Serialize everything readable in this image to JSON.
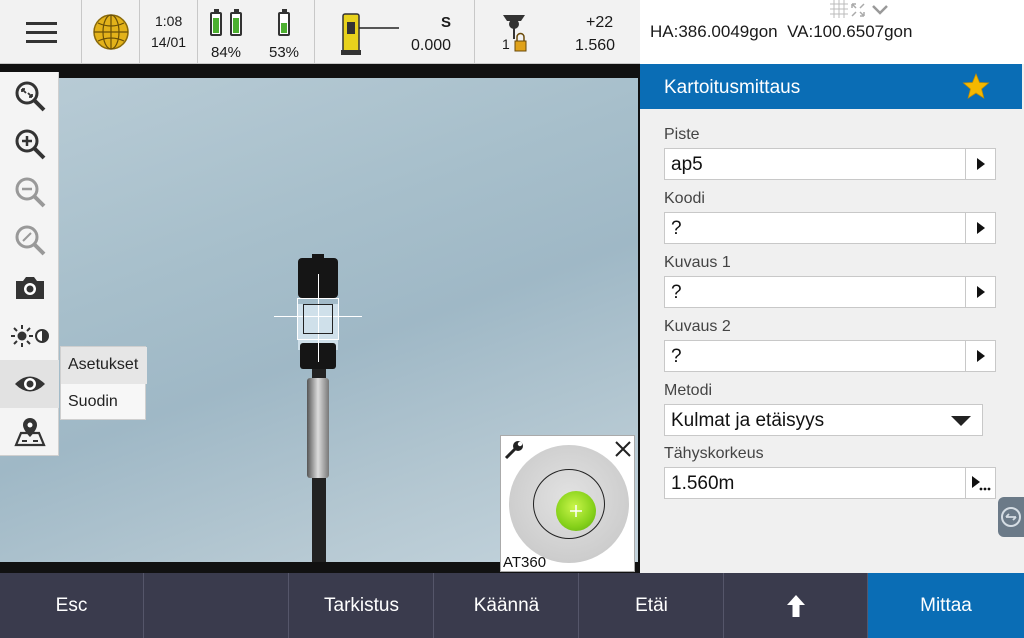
{
  "status_bar": {
    "time": "1:08",
    "date": "14/01",
    "battery_1": {
      "label": "84%",
      "level": 0.84
    },
    "battery_2": {
      "label": "53%",
      "level": 0.53
    },
    "instrument": {
      "mode": "S",
      "value": "0.000"
    },
    "target": {
      "id": "1",
      "prism_constant": "+22",
      "height": "1.560"
    },
    "icons": [
      "menu-icon",
      "gps-globe-icon",
      "total-station-icon",
      "target-lock-icon"
    ]
  },
  "angle_readout": {
    "ha": "HA:386.0049gon",
    "va": "VA:100.6507gon"
  },
  "camera_toolbar": {
    "icons": [
      "zoom-fit-icon",
      "zoom-in-icon",
      "zoom-out-icon",
      "zoom-reset-icon",
      "camera-icon",
      "brightness-contrast-icon",
      "eye-icon",
      "map-icon"
    ]
  },
  "popup_menu": {
    "items": [
      "Asetukset",
      "Suodin"
    ]
  },
  "level_bubble": {
    "label": "AT360"
  },
  "form": {
    "title": "Kartoitusmittaus",
    "fields": [
      {
        "label": "Piste",
        "value": "ap5"
      },
      {
        "label": "Koodi",
        "value": "?"
      },
      {
        "label": "Kuvaus 1",
        "value": "?"
      },
      {
        "label": "Kuvaus 2",
        "value": "?"
      },
      {
        "label": "Metodi",
        "value": "Kulmat ja etäisyys"
      },
      {
        "label": "Tähyskorkeus",
        "value": "1.560m"
      }
    ]
  },
  "softkeys": [
    "Esc",
    "",
    "Tarkistus",
    "Käännä",
    "Etäi",
    "shift-up-icon",
    "Mittaa"
  ],
  "colors": {
    "accent": "#0a6db5",
    "softkey_bg": "#3a3b4d",
    "bubble": "#86d11a",
    "star": "#f5b800"
  }
}
